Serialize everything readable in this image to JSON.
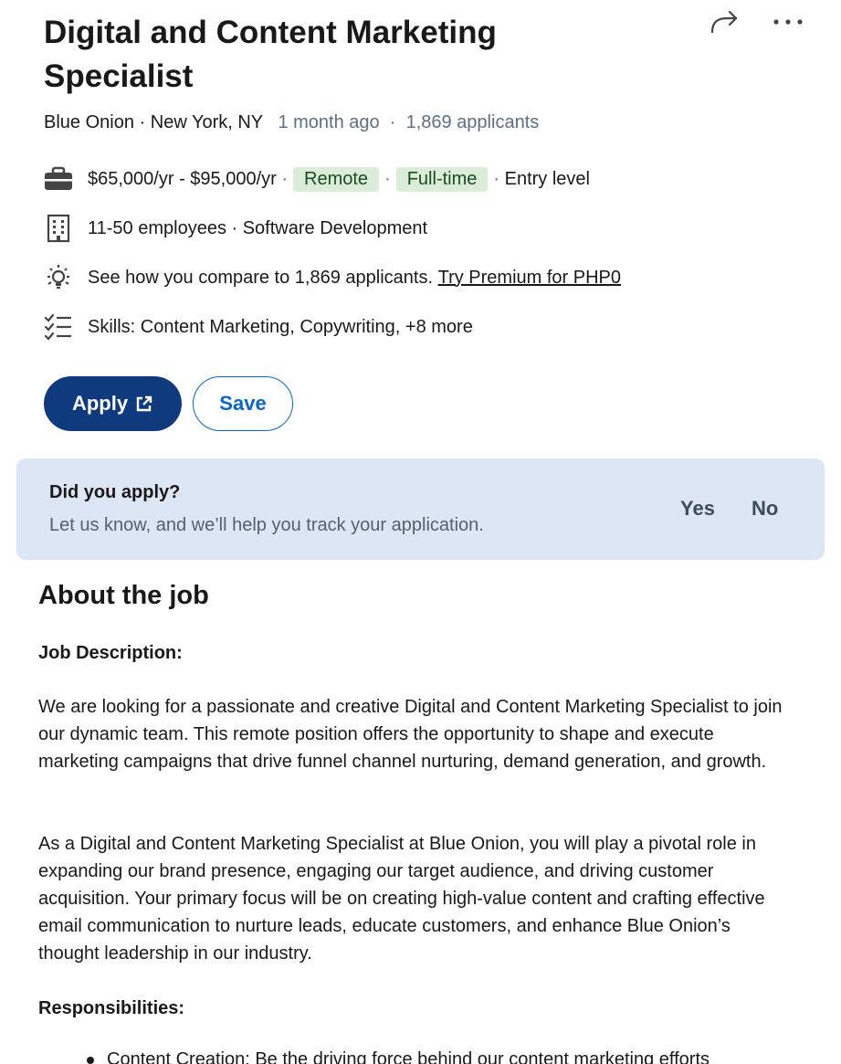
{
  "job": {
    "title": "Digital and Content Marketing Specialist",
    "company": "Blue Onion",
    "location": "New York, NY",
    "posted": "1 month ago",
    "applicants": "1,869 applicants"
  },
  "insights": {
    "salary": "$65,000/yr - $95,000/yr",
    "workplace": "Remote",
    "type": "Full-time",
    "level": "Entry level",
    "company_size": "11-50 employees · Software Development",
    "compare": "See how you compare to 1,869 applicants.",
    "premium_link": "Try Premium for PHP0",
    "skills": "Skills: Content Marketing, Copywriting, +8 more"
  },
  "buttons": {
    "apply": "Apply",
    "save": "Save"
  },
  "did_apply": {
    "question": "Did you apply?",
    "subtitle": "Let us know, and we’ll help you track your application.",
    "yes": "Yes",
    "no": "No"
  },
  "about": {
    "heading": "About the job",
    "desc_label": "Job Description:",
    "para1": "We are looking for a passionate and creative Digital and Content Marketing Specialist to join our dynamic team. This remote position offers the opportunity to shape and execute marketing campaigns that drive funnel channel nurturing, demand generation, and growth.",
    "para2": "As a Digital and Content Marketing Specialist at Blue Onion, you will play a pivotal role in expanding our brand presence, engaging our target audience, and driving customer acquisition. Your primary focus will be on creating high-value content and crafting effective email communication to nurture leads, educate customers, and enhance Blue Onion’s thought leadership in our industry.",
    "resp_label": "Responsibilities:",
    "bullet1": "Content Creation: Be the driving force behind our content marketing efforts"
  },
  "icons": {
    "share": "share-arrow-icon",
    "more": "more-dots-icon",
    "briefcase": "briefcase-icon",
    "building": "building-icon",
    "lightbulb": "lightbulb-icon",
    "checklist": "checklist-icon",
    "external": "external-link-icon"
  },
  "colors": {
    "apply_bg": "#0f3a7d",
    "save_text": "#0a66c2",
    "pill_bg": "#dbecd9",
    "panel_bg": "#dce6f5"
  }
}
